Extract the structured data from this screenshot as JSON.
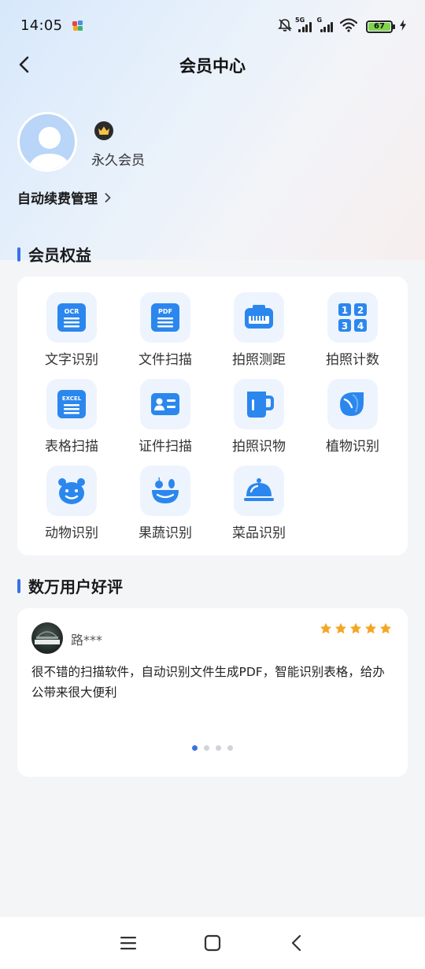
{
  "status_bar": {
    "time": "14:05",
    "network_1": "5G",
    "network_2": "G",
    "battery": "67"
  },
  "header": {
    "title": "会员中心",
    "back_icon": "chevron-left-icon"
  },
  "profile": {
    "member_type": "永久会员",
    "badge_icon": "crown-icon"
  },
  "renew": {
    "label": "自动续费管理",
    "icon": "chevron-right-icon"
  },
  "benefits": {
    "title": "会员权益",
    "items": [
      {
        "label": "文字识别",
        "icon": "ocr-icon",
        "icon_text": "OCR"
      },
      {
        "label": "文件扫描",
        "icon": "pdf-scan-icon",
        "icon_text": "PDF"
      },
      {
        "label": "拍照测距",
        "icon": "ruler-icon"
      },
      {
        "label": "拍照计数",
        "icon": "count-icon",
        "icon_text": [
          "1",
          "2",
          "3",
          "4"
        ]
      },
      {
        "label": "表格扫描",
        "icon": "excel-icon",
        "icon_text": "EXCEL"
      },
      {
        "label": "证件扫描",
        "icon": "id-card-icon"
      },
      {
        "label": "拍照识物",
        "icon": "mug-icon"
      },
      {
        "label": "植物识别",
        "icon": "leaf-icon"
      },
      {
        "label": "动物识别",
        "icon": "bear-icon"
      },
      {
        "label": "果蔬识别",
        "icon": "fruit-bowl-icon"
      },
      {
        "label": "菜品识别",
        "icon": "food-cloche-icon"
      }
    ]
  },
  "reviews": {
    "title": "数万用户好评",
    "current": {
      "name": "路***",
      "rating": 5,
      "text": "很不错的扫描软件，自动识别文件生成PDF，智能识别表格，给办公带来很大便利"
    },
    "page_count": 4,
    "active_page": 1
  },
  "colors": {
    "accent": "#3a72e6",
    "icon_blue": "#2b87ee",
    "star": "#f5a623",
    "icon_bg": "#eef4fd"
  },
  "system_nav": [
    "menu-icon",
    "home-icon",
    "back-icon"
  ]
}
